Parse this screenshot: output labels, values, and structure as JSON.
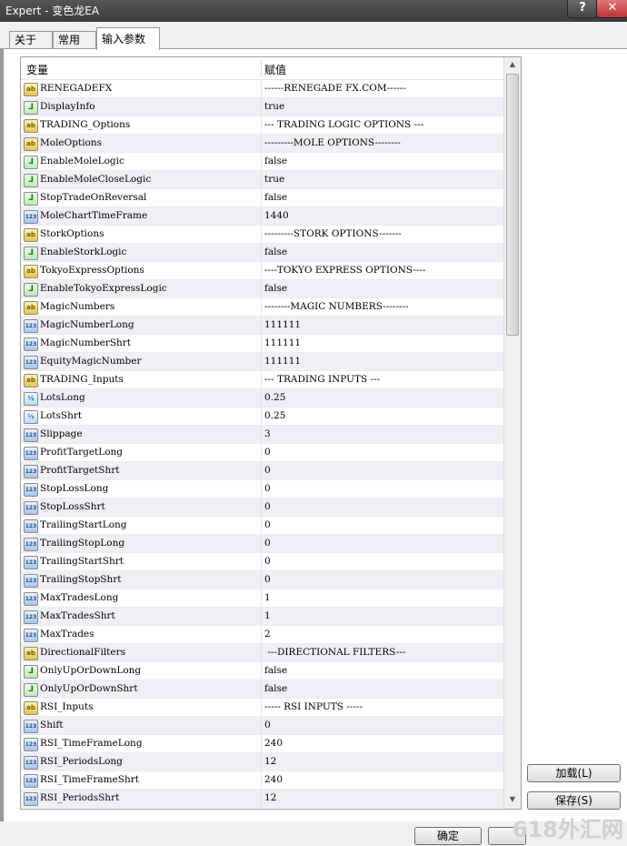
{
  "window": {
    "title": "Expert - 变色龙EA",
    "help": "?",
    "close": "✕"
  },
  "tabs": [
    {
      "label": "关于"
    },
    {
      "label": "常用"
    },
    {
      "label": "输入参数"
    }
  ],
  "table": {
    "col_variable": "变量",
    "col_value": "赋值",
    "rows": [
      {
        "icon": "ab",
        "name": "RENEGADEFX",
        "value": "------RENEGADE FX.COM------"
      },
      {
        "icon": "bool",
        "name": "DisplayInfo",
        "value": "true"
      },
      {
        "icon": "ab",
        "name": "TRADING_Options",
        "value": "--- TRADING LOGIC OPTIONS ---"
      },
      {
        "icon": "ab",
        "name": "MoleOptions",
        "value": "---------MOLE OPTIONS--------"
      },
      {
        "icon": "bool",
        "name": "EnableMoleLogic",
        "value": "false"
      },
      {
        "icon": "bool",
        "name": "EnableMoleCloseLogic",
        "value": "true"
      },
      {
        "icon": "bool",
        "name": "StopTradeOnReversal",
        "value": "false"
      },
      {
        "icon": "num",
        "name": "MoleChartTimeFrame",
        "value": "1440"
      },
      {
        "icon": "ab",
        "name": "StorkOptions",
        "value": "---------STORK OPTIONS-------"
      },
      {
        "icon": "bool",
        "name": "EnableStorkLogic",
        "value": "false"
      },
      {
        "icon": "ab",
        "name": "TokyoExpressOptions",
        "value": "----TOKYO EXPRESS OPTIONS----"
      },
      {
        "icon": "bool",
        "name": "EnableTokyoExpressLogic",
        "value": "false"
      },
      {
        "icon": "ab",
        "name": "MagicNumbers",
        "value": "--------MAGIC NUMBERS--------"
      },
      {
        "icon": "num",
        "name": "MagicNumberLong",
        "value": "111111"
      },
      {
        "icon": "num",
        "name": "MagicNumberShrt",
        "value": "111111"
      },
      {
        "icon": "num",
        "name": "EquityMagicNumber",
        "value": "111111"
      },
      {
        "icon": "ab",
        "name": "TRADING_Inputs",
        "value": "--- TRADING INPUTS ---"
      },
      {
        "icon": "frac",
        "name": "LotsLong",
        "value": "0.25"
      },
      {
        "icon": "frac",
        "name": "LotsShrt",
        "value": "0.25"
      },
      {
        "icon": "num",
        "name": "Slippage",
        "value": "3"
      },
      {
        "icon": "num",
        "name": "ProfitTargetLong",
        "value": "0"
      },
      {
        "icon": "num",
        "name": "ProfitTargetShrt",
        "value": "0"
      },
      {
        "icon": "num",
        "name": "StopLossLong",
        "value": "0"
      },
      {
        "icon": "num",
        "name": "StopLossShrt",
        "value": "0"
      },
      {
        "icon": "num",
        "name": "TrailingStartLong",
        "value": "0"
      },
      {
        "icon": "num",
        "name": "TrailingStopLong",
        "value": "0"
      },
      {
        "icon": "num",
        "name": "TrailingStartShrt",
        "value": "0"
      },
      {
        "icon": "num",
        "name": "TrailingStopShrt",
        "value": "0"
      },
      {
        "icon": "num",
        "name": "MaxTradesLong",
        "value": "1"
      },
      {
        "icon": "num",
        "name": "MaxTradesShrt",
        "value": "1"
      },
      {
        "icon": "num",
        "name": "MaxTrades",
        "value": "2"
      },
      {
        "icon": "ab",
        "name": "DirectionalFilters",
        "value": " ---DIRECTIONAL FILTERS---"
      },
      {
        "icon": "bool",
        "name": "OnlyUpOrDownLong",
        "value": "false"
      },
      {
        "icon": "bool",
        "name": "OnlyUpOrDownShrt",
        "value": "false"
      },
      {
        "icon": "ab",
        "name": "RSI_Inputs",
        "value": "----- RSI INPUTS -----"
      },
      {
        "icon": "num",
        "name": "Shift",
        "value": "0"
      },
      {
        "icon": "num",
        "name": "RSI_TimeFrameLong",
        "value": "240"
      },
      {
        "icon": "num",
        "name": "RSI_PeriodsLong",
        "value": "12"
      },
      {
        "icon": "num",
        "name": "RSI_TimeFrameShrt",
        "value": "240"
      },
      {
        "icon": "num",
        "name": "RSI_PeriodsShrt",
        "value": "12"
      }
    ]
  },
  "icons": {
    "ab": "ab",
    "bool": "⅃",
    "num": "123",
    "frac": "½"
  },
  "buttons": {
    "load": "加载(L)",
    "save": "保存(S)",
    "ok": "确定",
    "cancel": ""
  },
  "watermark": "618外汇网"
}
